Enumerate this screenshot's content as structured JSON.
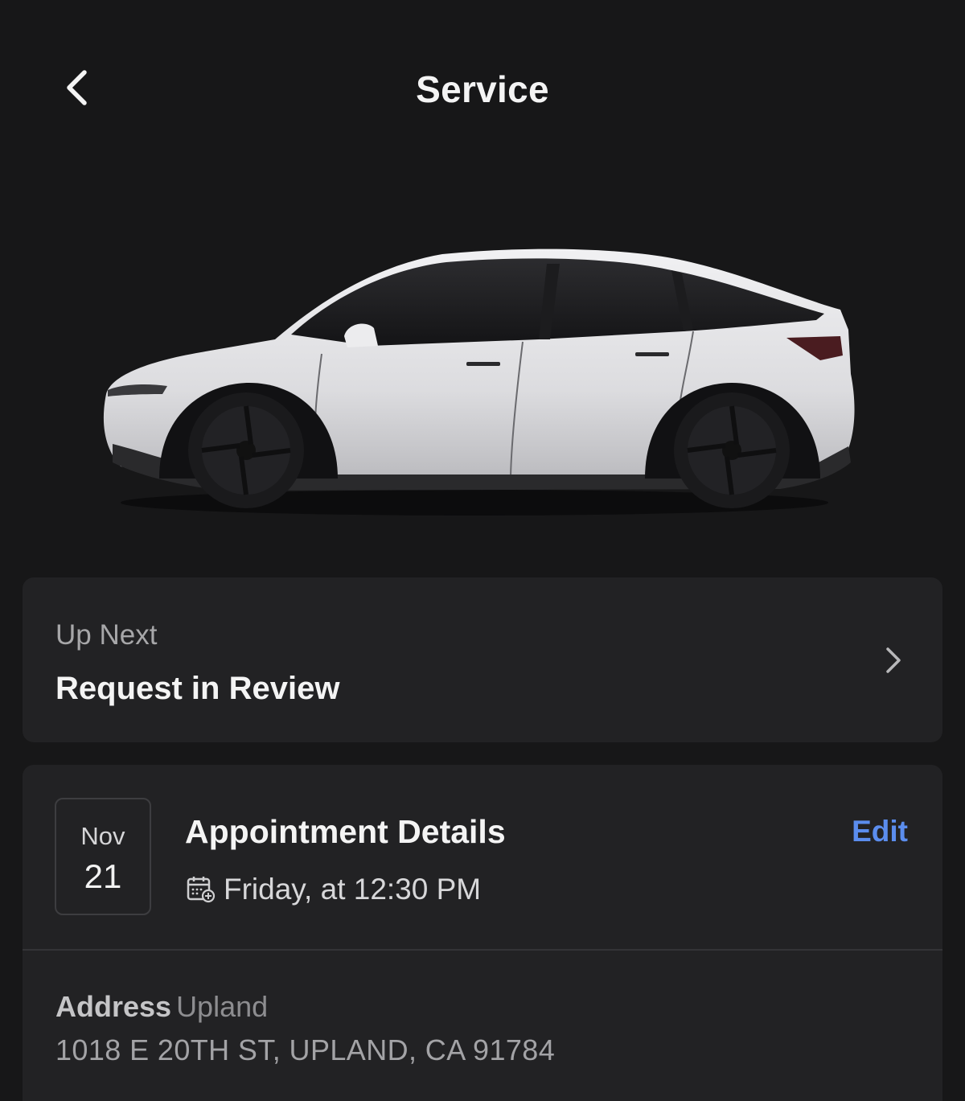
{
  "header": {
    "title": "Service",
    "back_icon": "chevron-left-icon"
  },
  "vehicle": {
    "image": "white-suv-side-view",
    "body_color": "#e7e7e9"
  },
  "up_next": {
    "label": "Up Next",
    "status": "Request in Review",
    "chevron_icon": "chevron-right-icon"
  },
  "appointment": {
    "month": "Nov",
    "day": "21",
    "title": "Appointment Details",
    "edit_label": "Edit",
    "edit_color": "#5b8dee",
    "calendar_icon": "calendar-add-icon",
    "when": "Friday, at 12:30 PM",
    "address_label": "Address",
    "address_city": "Upland",
    "address_street": "1018 E 20TH ST, UPLAND, CA 91784"
  }
}
